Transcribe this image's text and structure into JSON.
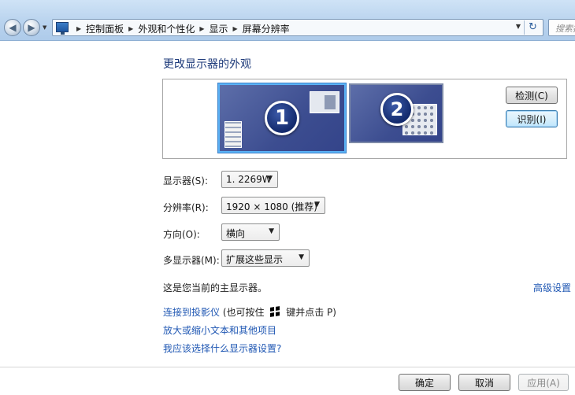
{
  "address_bar": {
    "breadcrumbs": [
      "控制面板",
      "外观和个性化",
      "显示",
      "屏幕分辨率"
    ],
    "search_placeholder": "搜索控"
  },
  "page_title": "更改显示器的外观",
  "monitors": {
    "monitor1_number": "1",
    "monitor2_number": "2",
    "detect_button": "检测(C)",
    "identify_button": "识别(I)"
  },
  "settings": {
    "display_label": "显示器(S):",
    "display_value": "1. 2269W",
    "resolution_label": "分辨率(R):",
    "resolution_value": "1920 × 1080 (推荐)",
    "orientation_label": "方向(O):",
    "orientation_value": "横向",
    "multi_display_label": "多显示器(M):",
    "multi_display_value": "扩展这些显示"
  },
  "primary_note": "这是您当前的主显示器。",
  "advanced_link": "高级设置",
  "links": {
    "projector_link": "连接到投影仪",
    "projector_hint_prefix": "(也可按住",
    "projector_hint_suffix": "键并点击 P)",
    "text_size_link": "放大或缩小文本和其他项目",
    "help_link": "我应该选择什么显示器设置?"
  },
  "footer": {
    "ok": "确定",
    "cancel": "取消",
    "apply": "应用(A)"
  },
  "icons": [
    "back-arrow-icon",
    "forward-arrow-icon",
    "control-panel-icon",
    "refresh-icon",
    "windows-key-icon"
  ]
}
